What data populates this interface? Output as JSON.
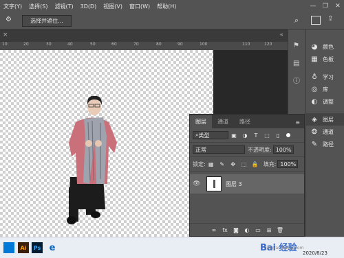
{
  "menu": [
    "文字(Y)",
    "选择(S)",
    "滤镜(T)",
    "3D(D)",
    "视图(V)",
    "窗口(W)",
    "帮助(H)"
  ],
  "options": {
    "select_mask_label": "选择并遮住..."
  },
  "ruler_ticks": [
    "10",
    "20",
    "30",
    "40",
    "50",
    "60",
    "70",
    "80",
    "90",
    "100",
    "110",
    "120"
  ],
  "right_panels": [
    {
      "icon": "palette-icon",
      "label": "颜色"
    },
    {
      "icon": "swatches-icon",
      "label": "色板"
    },
    {
      "icon": "lightbulb-icon",
      "label": "学习"
    },
    {
      "icon": "library-icon",
      "label": "库"
    },
    {
      "icon": "adjustments-icon",
      "label": "调整"
    },
    {
      "icon": "layers-icon",
      "label": "图层"
    },
    {
      "icon": "channels-icon",
      "label": "通道"
    },
    {
      "icon": "paths-icon",
      "label": "路径"
    }
  ],
  "layers_panel": {
    "tabs": [
      "图层",
      "通道",
      "路径"
    ],
    "filter_kind": "类型",
    "blend_mode": "正常",
    "opacity_label": "不透明度:",
    "opacity_value": "100%",
    "lock_label": "锁定:",
    "fill_label": "填充:",
    "fill_value": "100%",
    "layer_name": "图层 3",
    "bottom_icons": [
      "link-icon",
      "fx-icon",
      "mask-icon",
      "adjustment-icon",
      "folder-icon",
      "new-layer-icon",
      "trash-icon"
    ]
  },
  "taskbar": {
    "date": "2020/8/23",
    "watermark": "Bai 经验",
    "watermark_sub": "jingyan.baidu.com"
  },
  "colors": {
    "ui_bg": "#535353",
    "canvas_dark": "#282828",
    "coat": "#c9707a",
    "scarf": "#9fa3ad"
  }
}
